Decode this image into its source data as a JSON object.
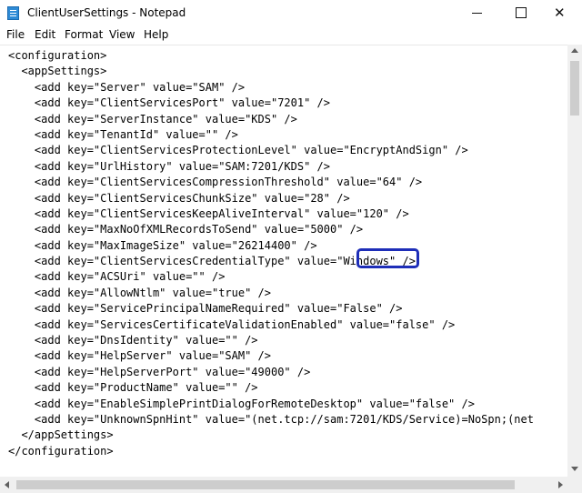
{
  "window": {
    "title": "ClientUserSettings - Notepad",
    "icon": "notepad-icon",
    "controls": {
      "minimize": "minimize-icon",
      "maximize": "maximize-icon",
      "close": "✕"
    }
  },
  "menu": [
    "File",
    "Edit",
    "Format",
    "View",
    "Help"
  ],
  "editor": {
    "highlight_color": "#1e2eb8",
    "highlighted_value": "\"Windows\"",
    "lines": [
      "<configuration>",
      "  <appSettings>",
      "    <add key=\"Server\" value=\"SAM\" />",
      "    <add key=\"ClientServicesPort\" value=\"7201\" />",
      "    <add key=\"ServerInstance\" value=\"KDS\" />",
      "    <add key=\"TenantId\" value=\"\" />",
      "    <add key=\"ClientServicesProtectionLevel\" value=\"EncryptAndSign\" />",
      "    <add key=\"UrlHistory\" value=\"SAM:7201/KDS\" />",
      "    <add key=\"ClientServicesCompressionThreshold\" value=\"64\" />",
      "    <add key=\"ClientServicesChunkSize\" value=\"28\" />",
      "    <add key=\"ClientServicesKeepAliveInterval\" value=\"120\" />",
      "    <add key=\"MaxNoOfXMLRecordsToSend\" value=\"5000\" />",
      "    <add key=\"MaxImageSize\" value=\"26214400\" />",
      "    <add key=\"ClientServicesCredentialType\" value=\"Windows\" />",
      "    <add key=\"ACSUri\" value=\"\" />",
      "    <add key=\"AllowNtlm\" value=\"true\" />",
      "    <add key=\"ServicePrincipalNameRequired\" value=\"False\" />",
      "    <add key=\"ServicesCertificateValidationEnabled\" value=\"false\" />",
      "    <add key=\"DnsIdentity\" value=\"\" />",
      "    <add key=\"HelpServer\" value=\"SAM\" />",
      "    <add key=\"HelpServerPort\" value=\"49000\" />",
      "    <add key=\"ProductName\" value=\"\" />",
      "    <add key=\"EnableSimplePrintDialogForRemoteDesktop\" value=\"false\" />",
      "    <add key=\"UnknownSpnHint\" value=\"(net.tcp://sam:7201/KDS/Service)=NoSpn;(net",
      "  </appSettings>",
      "</configuration>"
    ]
  }
}
